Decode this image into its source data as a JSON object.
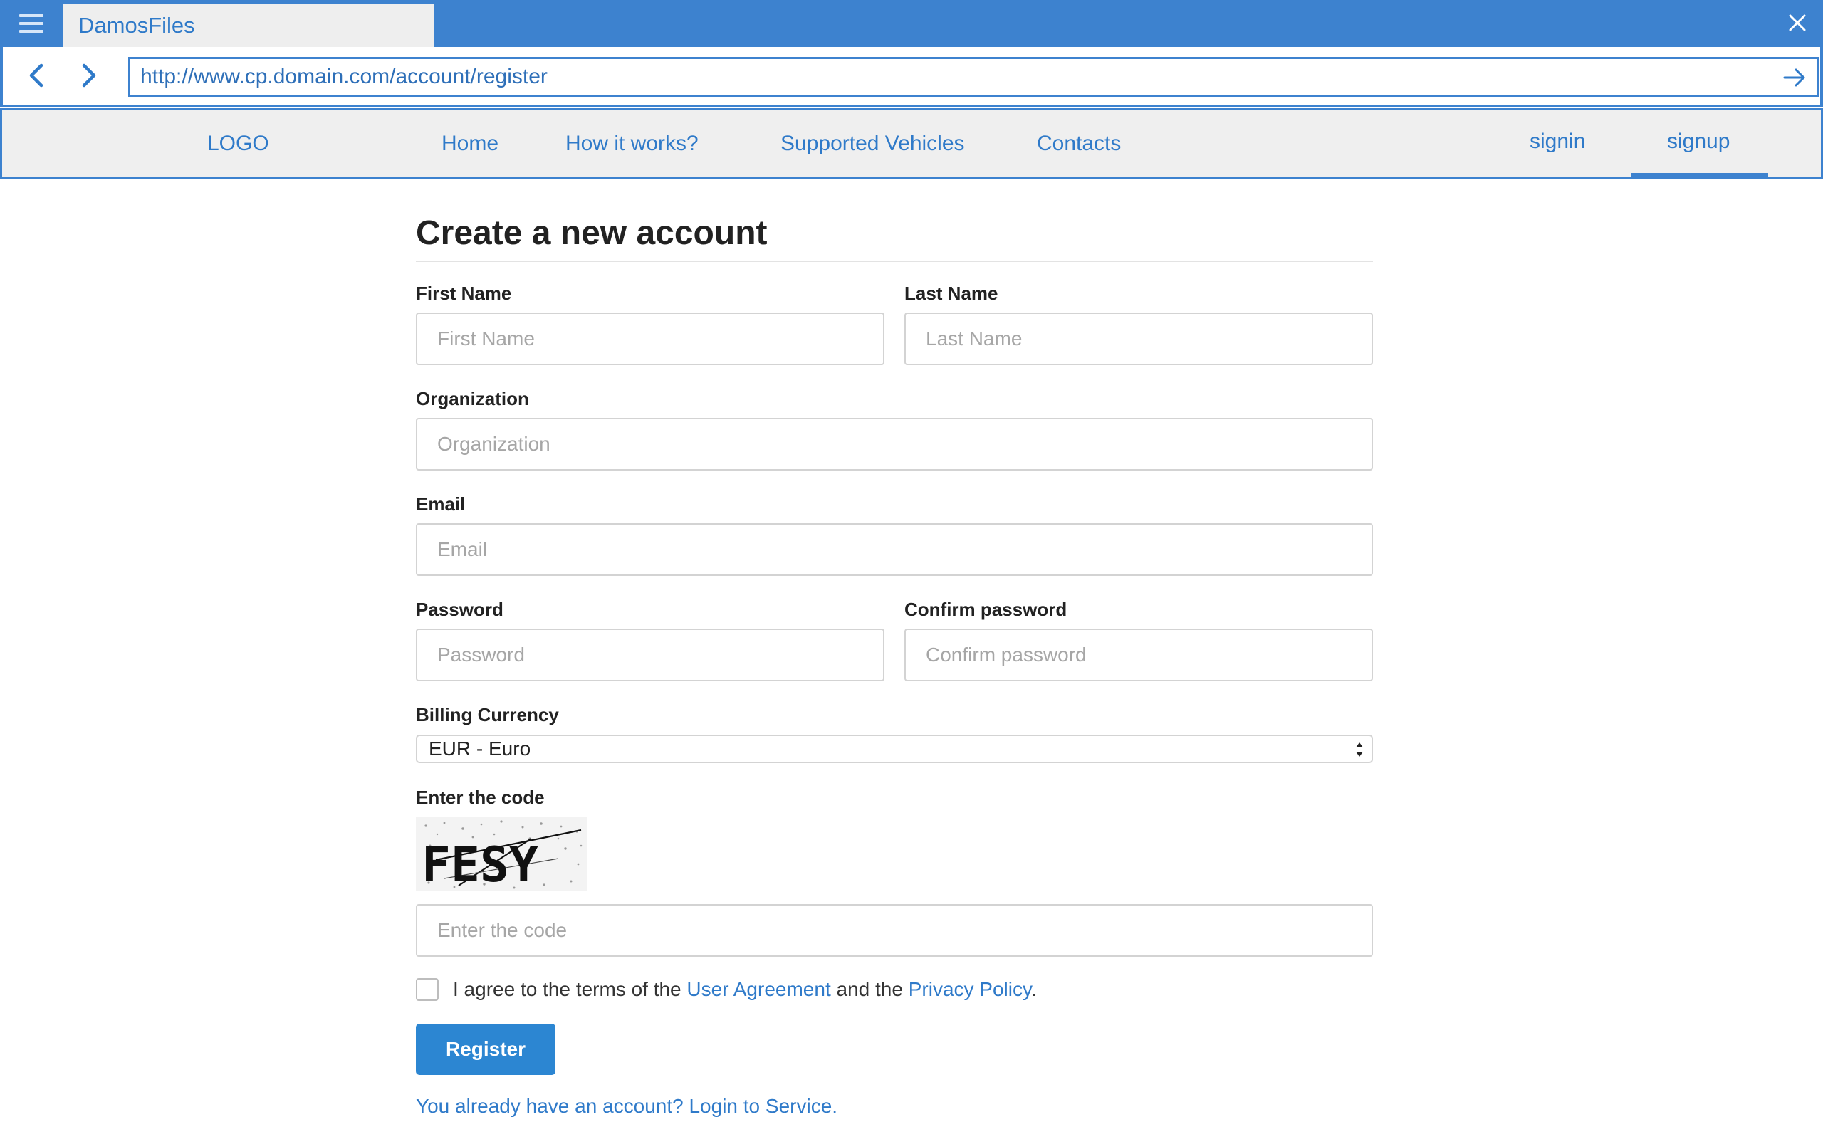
{
  "window": {
    "tab_title": "DamosFiles",
    "url": "http://www.cp.domain.com/account/register",
    "accent_color": "#3d82cf"
  },
  "site_nav": {
    "logo": "LOGO",
    "items": [
      "Home",
      "How it works?",
      "Supported Vehicles",
      "Contacts"
    ],
    "signin": "signin",
    "signup": "signup",
    "active": "signup"
  },
  "form": {
    "title": "Create a new account",
    "first_name": {
      "label": "First Name",
      "placeholder": "First Name",
      "value": ""
    },
    "last_name": {
      "label": "Last Name",
      "placeholder": "Last Name",
      "value": ""
    },
    "organization": {
      "label": "Organization",
      "placeholder": "Organization",
      "value": ""
    },
    "email": {
      "label": "Email",
      "placeholder": "Email",
      "value": ""
    },
    "password": {
      "label": "Password",
      "placeholder": "Password",
      "value": ""
    },
    "confirm_password": {
      "label": "Confirm password",
      "placeholder": "Confirm password",
      "value": ""
    },
    "billing_currency": {
      "label": "Billing Currency",
      "selected": "EUR - Euro"
    },
    "captcha": {
      "label": "Enter the code",
      "image_text": "FESY",
      "placeholder": "Enter the code",
      "value": ""
    },
    "agree": {
      "prefix": "I agree to the terms of the ",
      "user_agreement": "User Agreement",
      "middle": " and the ",
      "privacy_policy": "Privacy Policy",
      "suffix": ".",
      "checked": false
    },
    "register_label": "Register",
    "login_prompt": "You already have an account? Login to Service."
  }
}
